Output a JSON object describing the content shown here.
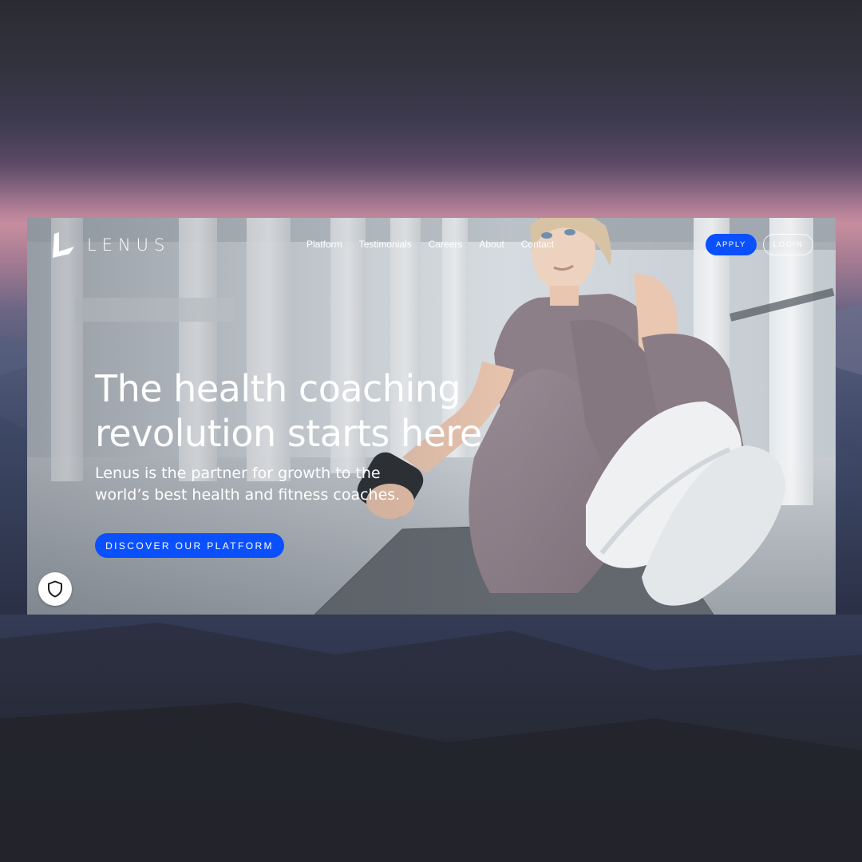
{
  "brand": {
    "name": "LENUS",
    "accent_color": "#0a50ff"
  },
  "nav": {
    "items": [
      {
        "label": "Platform"
      },
      {
        "label": "Testimonials"
      },
      {
        "label": "Careers"
      },
      {
        "label": "About"
      },
      {
        "label": "Contact"
      }
    ],
    "apply_label": "APPLY",
    "login_label": "LOGIN"
  },
  "hero": {
    "headline_line1": "The health coaching",
    "headline_line2": "revolution starts here",
    "subhead_line1": "Lenus is the partner for growth to the",
    "subhead_line2": "world’s best health and fitness coaches.",
    "cta_label": "DISCOVER OUR PLATFORM",
    "image_subject": "woman-in-activewear-sitting-on-yoga-mat"
  },
  "widgets": {
    "privacy_icon": "shield-icon"
  }
}
